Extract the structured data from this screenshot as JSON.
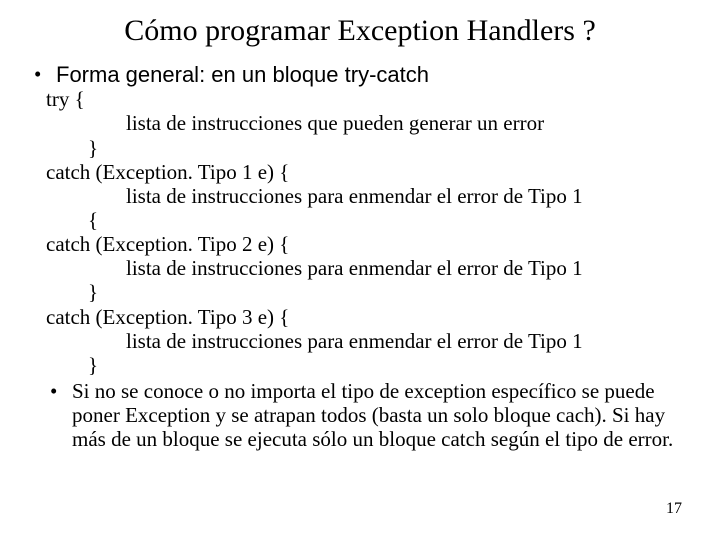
{
  "title": "Cómo programar Exception Handlers ?",
  "bullet1": "Forma general: en un bloque try-catch",
  "code": {
    "l1": "try {",
    "l2": "lista de instrucciones que pueden generar un error",
    "l3": "}",
    "l4": "catch (Exception. Tipo 1 e) {",
    "l5": "lista de instrucciones para enmendar el error de Tipo 1",
    "l6": "{",
    "l7": "catch (Exception. Tipo 2 e) {",
    "l8": "lista de instrucciones para enmendar el error de Tipo 1",
    "l9": "}",
    "l10": "catch (Exception. Tipo 3 e) {",
    "l11": "lista de instrucciones para enmendar el error de Tipo 1",
    "l12": "}"
  },
  "bullet2": "Si no se conoce o no importa el tipo de exception específico se puede poner Exception y se atrapan todos (basta un solo bloque cach). Si hay más de un bloque se ejecuta sólo un bloque catch según el tipo de error.",
  "page": "17"
}
